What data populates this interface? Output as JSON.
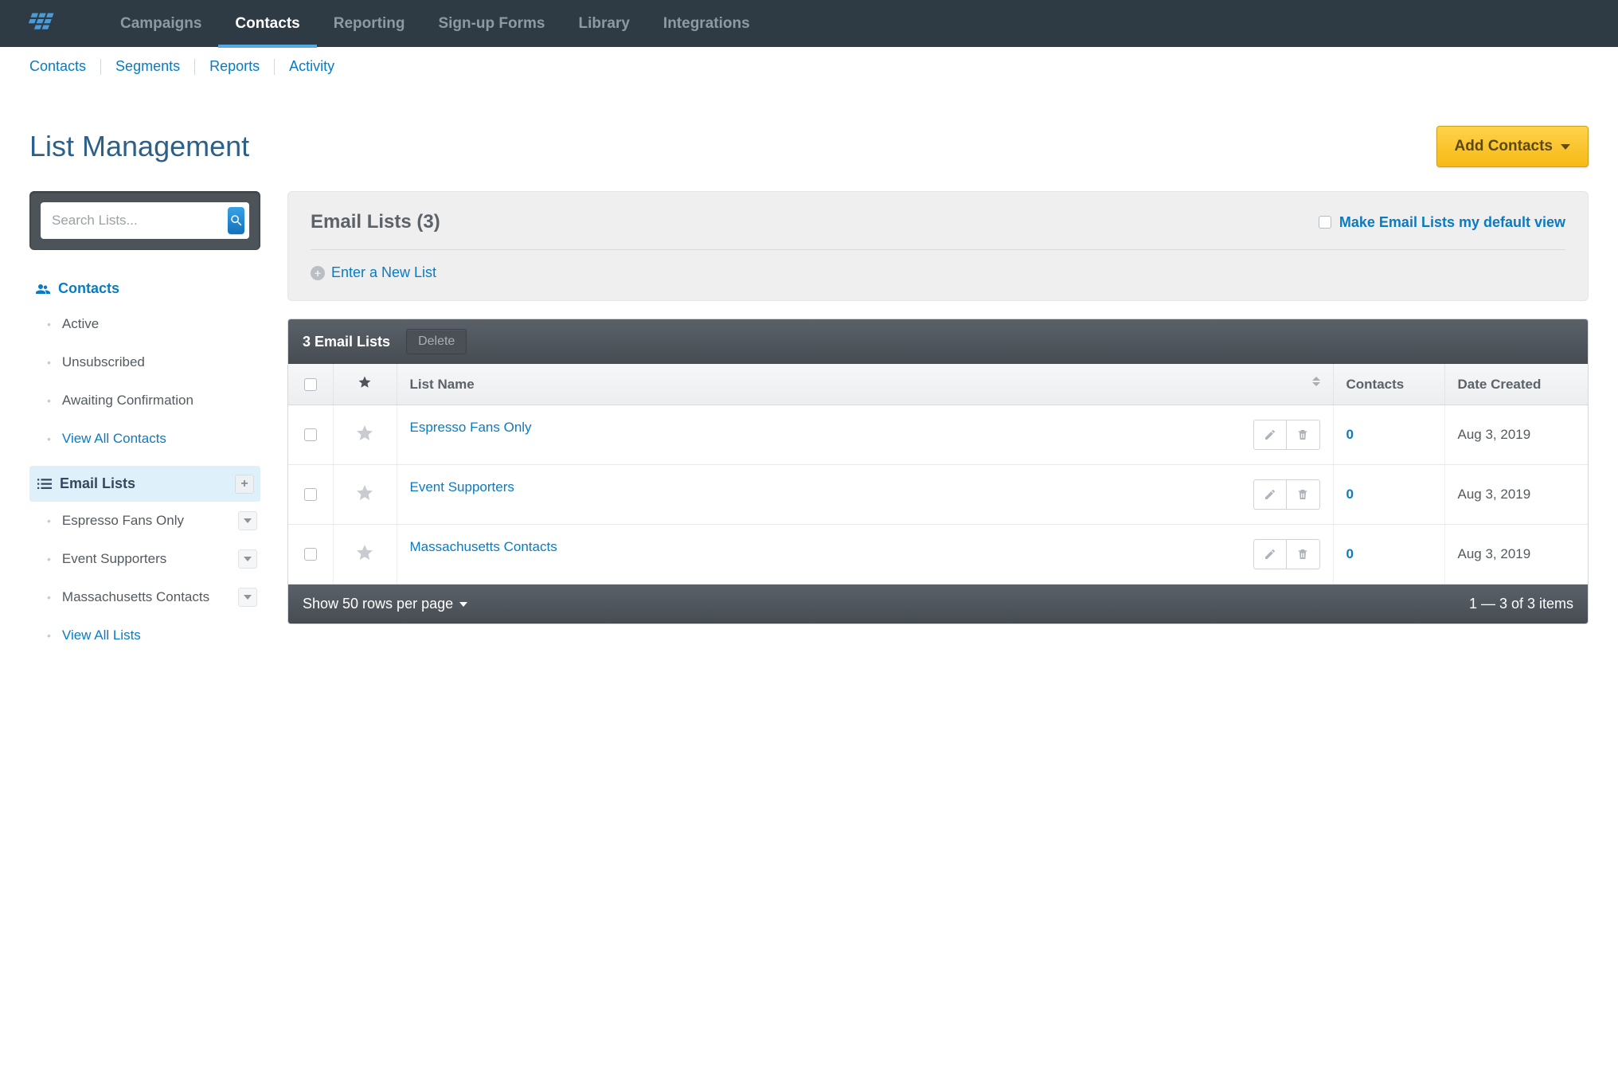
{
  "topnav": {
    "items": [
      {
        "label": "Campaigns",
        "active": false
      },
      {
        "label": "Contacts",
        "active": true
      },
      {
        "label": "Reporting",
        "active": false
      },
      {
        "label": "Sign-up Forms",
        "active": false
      },
      {
        "label": "Library",
        "active": false
      },
      {
        "label": "Integrations",
        "active": false
      }
    ]
  },
  "subnav": {
    "items": [
      {
        "label": "Contacts"
      },
      {
        "label": "Segments"
      },
      {
        "label": "Reports"
      },
      {
        "label": "Activity"
      }
    ]
  },
  "page": {
    "title": "List Management",
    "add_button": "Add Contacts"
  },
  "sidebar": {
    "search_placeholder": "Search Lists...",
    "contacts_section": {
      "heading": "Contacts",
      "items": [
        {
          "label": "Active"
        },
        {
          "label": "Unsubscribed"
        },
        {
          "label": "Awaiting Confirmation"
        },
        {
          "label": "View All Contacts",
          "link": true
        }
      ]
    },
    "email_lists_section": {
      "heading": "Email Lists",
      "items": [
        {
          "label": "Espresso Fans Only",
          "dd": true
        },
        {
          "label": "Event Supporters",
          "dd": true
        },
        {
          "label": "Massachusetts Contacts",
          "dd": true
        },
        {
          "label": "View All Lists",
          "link": true
        }
      ]
    }
  },
  "panel": {
    "title": "Email Lists (3)",
    "default_view_label": "Make Email Lists my default view",
    "enter_new_list": "Enter a New List"
  },
  "table": {
    "bar_title": "3 Email Lists",
    "delete_label": "Delete",
    "headers": {
      "list_name": "List Name",
      "contacts": "Contacts",
      "date_created": "Date Created"
    },
    "rows": [
      {
        "name": "Espresso Fans Only",
        "contacts": "0",
        "date": "Aug 3, 2019"
      },
      {
        "name": "Event Supporters",
        "contacts": "0",
        "date": "Aug 3, 2019"
      },
      {
        "name": "Massachusetts Contacts",
        "contacts": "0",
        "date": "Aug 3, 2019"
      }
    ],
    "footer": {
      "rows_per_page": "Show 50 rows per page",
      "pagination": "1 — 3 of 3 items"
    }
  }
}
